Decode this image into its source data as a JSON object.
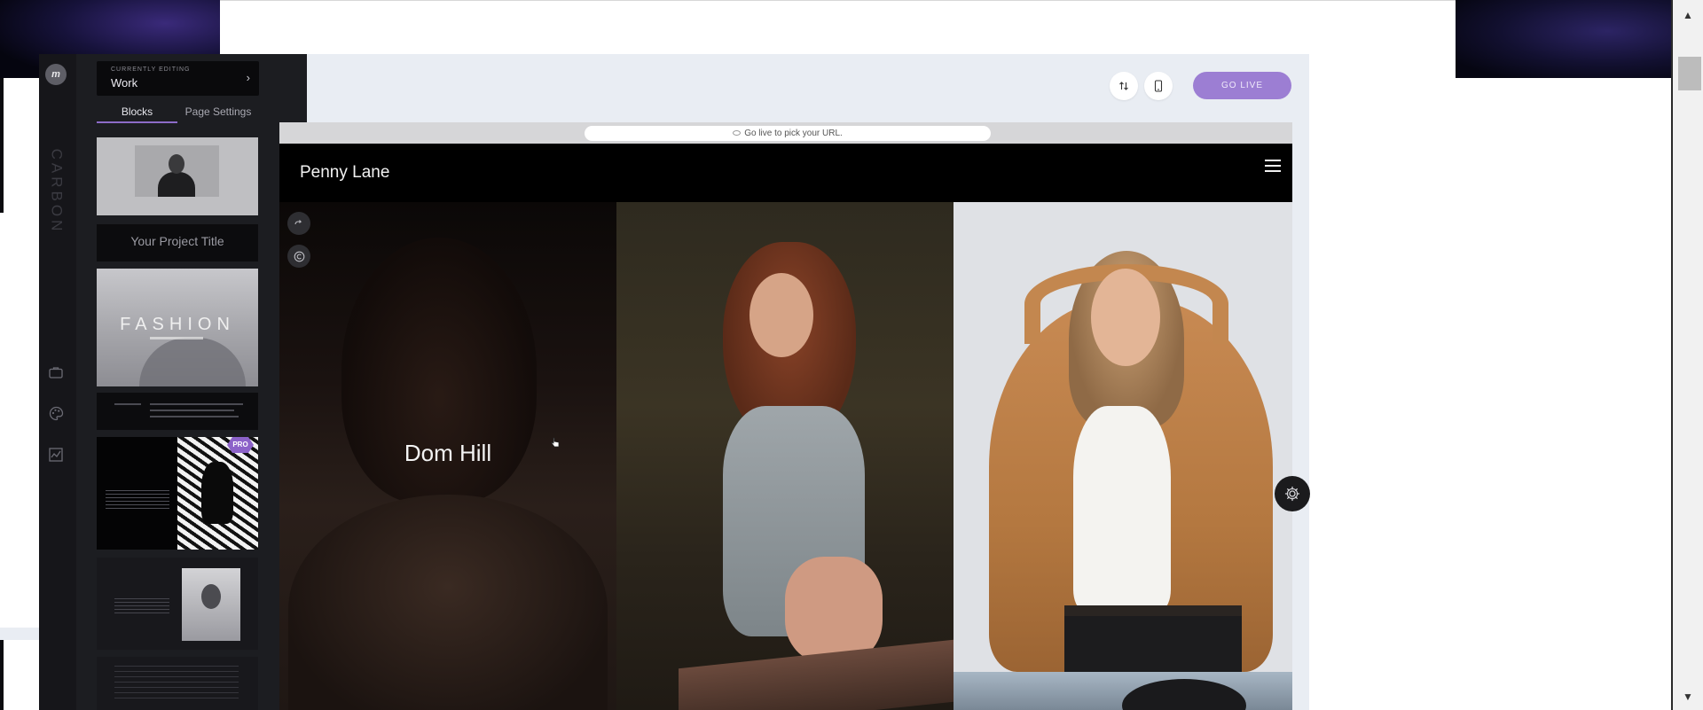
{
  "app": {
    "brand": "CARBON",
    "logo_letter": "m"
  },
  "panel": {
    "currently_editing_label": "CURRENTLY EDITING",
    "currently_editing_value": "Work",
    "tabs": [
      {
        "label": "Blocks",
        "active": true
      },
      {
        "label": "Page Settings",
        "active": false
      }
    ],
    "thumbnails": {
      "project_title": "Your Project Title",
      "fashion_title": "FASHION",
      "pro_badge": "PRO"
    }
  },
  "rail": {
    "icons": [
      "briefcase-icon",
      "palette-icon",
      "analytics-icon"
    ]
  },
  "toolbar": {
    "sort_icon": "sort-arrows-icon",
    "mobile_icon": "mobile-preview-icon",
    "go_live_label": "GO LIVE"
  },
  "preview": {
    "url_hint": "Go live to pick your URL.",
    "site_name": "Penny Lane",
    "gallery": [
      {
        "title": "Dom Hill"
      }
    ]
  },
  "colors": {
    "accent": "#9c7ed3",
    "tab_underline": "#8c6bc8",
    "panel_bg": "#1c1d21",
    "editor_bg": "#e9edf3"
  }
}
